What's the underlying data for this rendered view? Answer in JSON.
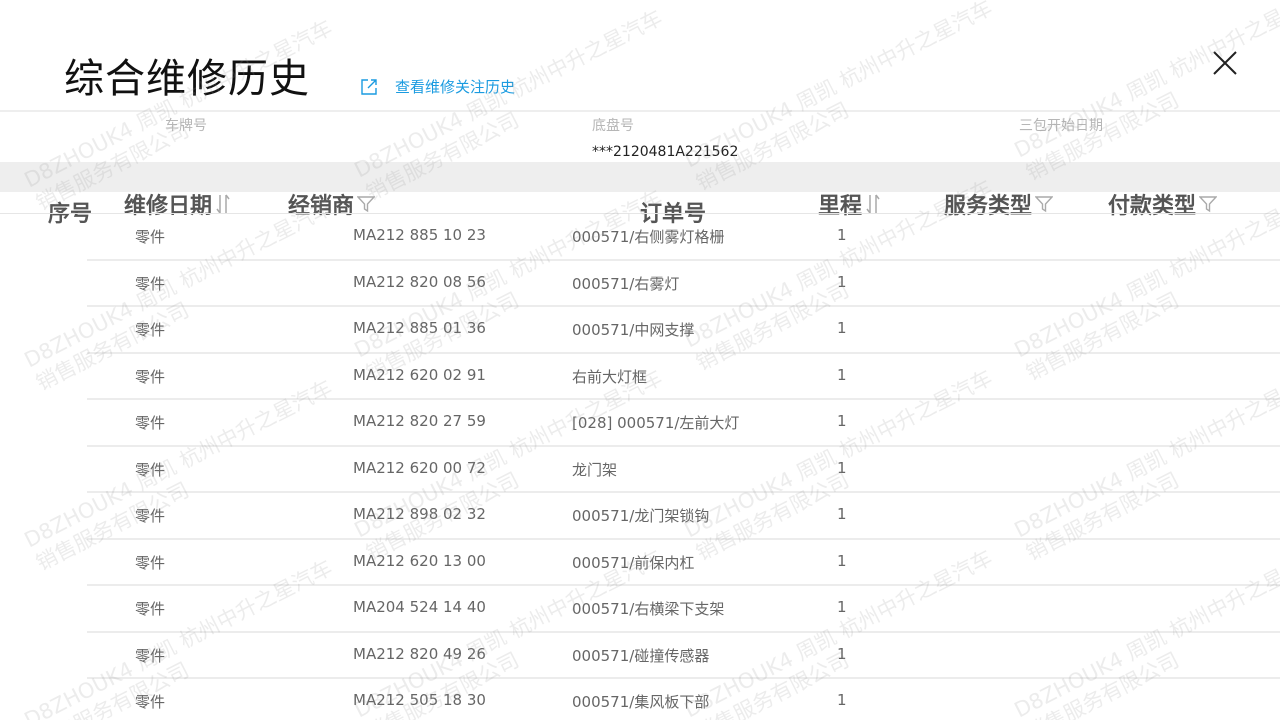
{
  "dialog": {
    "title": "综合维修历史",
    "history_link": "查看维修关注历史"
  },
  "info": {
    "plate_label": "车牌号",
    "plate_value": "",
    "chassis_label": "底盘号",
    "chassis_value": "***2120481A221562",
    "warranty_label": "三包开始日期",
    "warranty_value": ""
  },
  "table": {
    "columns": {
      "seq": "序号",
      "date": "维修日期",
      "dealer": "经销商",
      "order": "订单号",
      "mileage": "里程",
      "service_type": "服务类型",
      "payment_type": "付款类型"
    },
    "rows": [
      {
        "type": "零件",
        "part_no": "MA212 885 10 23",
        "name": "000571/右侧雾灯格栅",
        "qty": "1"
      },
      {
        "type": "零件",
        "part_no": "MA212 820 08 56",
        "name": "000571/右雾灯",
        "qty": "1"
      },
      {
        "type": "零件",
        "part_no": "MA212 885 01 36",
        "name": "000571/中网支撑",
        "qty": "1"
      },
      {
        "type": "零件",
        "part_no": "MA212 620 02 91",
        "name": "右前大灯框",
        "qty": "1"
      },
      {
        "type": "零件",
        "part_no": "MA212 820 27 59",
        "name": "[028] 000571/左前大灯",
        "qty": "1"
      },
      {
        "type": "零件",
        "part_no": "MA212 620 00 72",
        "name": "龙门架",
        "qty": "1"
      },
      {
        "type": "零件",
        "part_no": "MA212 898 02 32",
        "name": "000571/龙门架锁钩",
        "qty": "1"
      },
      {
        "type": "零件",
        "part_no": "MA212 620 13 00",
        "name": "000571/前保内杠",
        "qty": "1"
      },
      {
        "type": "零件",
        "part_no": "MA204 524 14 40",
        "name": "000571/右横梁下支架",
        "qty": "1"
      },
      {
        "type": "零件",
        "part_no": "MA212 820 49 26",
        "name": "000571/碰撞传感器",
        "qty": "1"
      },
      {
        "type": "零件",
        "part_no": "MA212 505 18 30",
        "name": "000571/集风板下部",
        "qty": "1"
      }
    ]
  },
  "watermark": {
    "line1": "D8ZHOUK4 周凯 杭州中升之星汽车",
    "line2": "销售服务有限公司"
  },
  "colors": {
    "accent": "#1a9be0",
    "band": "#eeeeee"
  },
  "icons": {
    "history_link": "external-link-icon",
    "close": "close-icon",
    "sort": "sort-icon",
    "filter": "filter-icon"
  }
}
